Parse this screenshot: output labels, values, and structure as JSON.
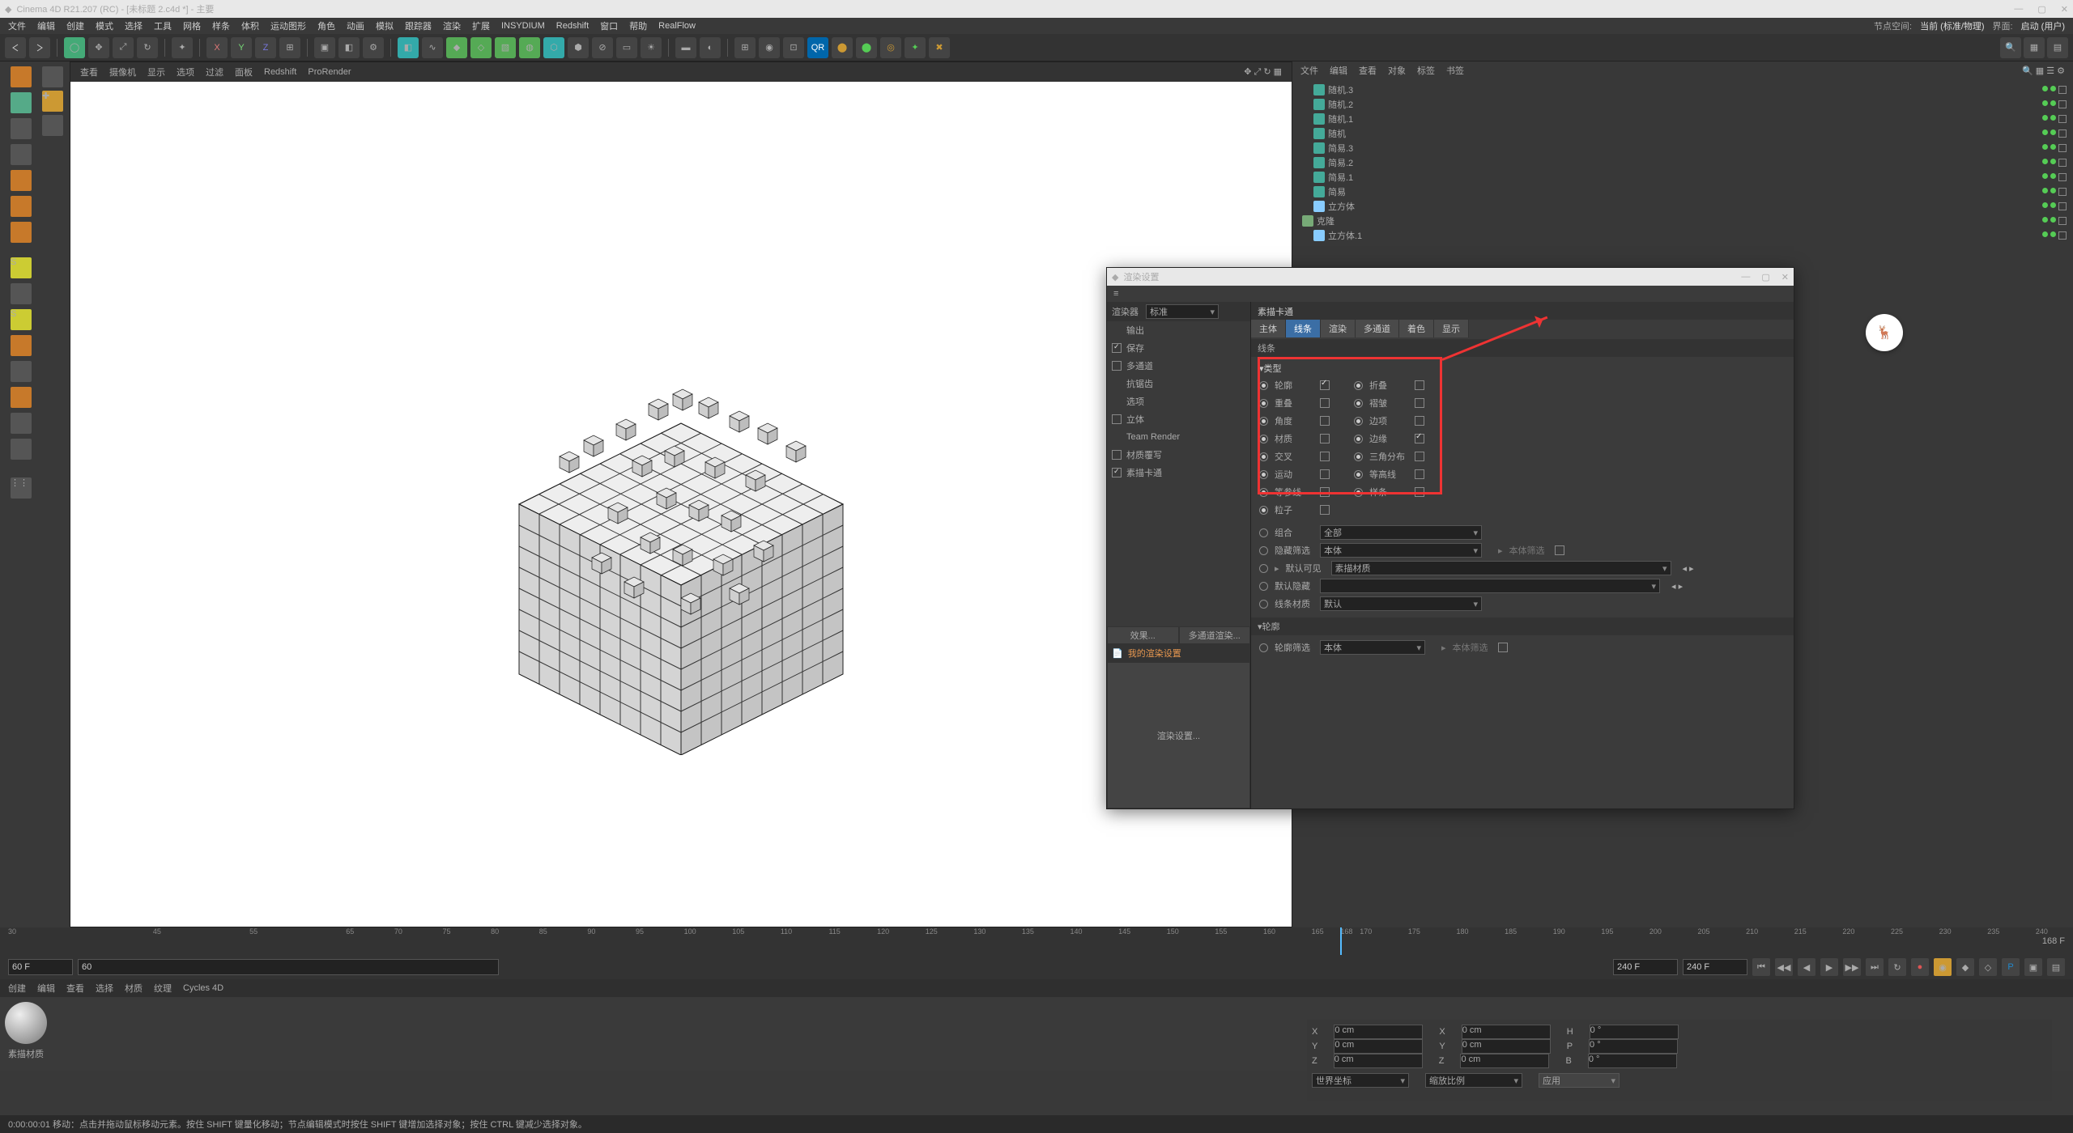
{
  "app": {
    "title": "Cinema 4D R21.207 (RC) - [未标题 2.c4d *] - 主要",
    "node_space_label": "节点空间:",
    "node_space_value": "当前 (标准/物理)",
    "layout_label": "界面:",
    "layout_value": "启动 (用户)"
  },
  "menus": [
    "文件",
    "编辑",
    "创建",
    "模式",
    "选择",
    "工具",
    "网格",
    "样条",
    "体积",
    "运动图形",
    "角色",
    "动画",
    "模拟",
    "跟踪器",
    "渲染",
    "扩展",
    "INSYDIUM",
    "Redshift",
    "窗口",
    "帮助",
    "RealFlow"
  ],
  "viewport_tabs": [
    "查看",
    "摄像机",
    "显示",
    "选项",
    "过滤",
    "面板",
    "Redshift",
    "ProRender"
  ],
  "objmgr_menu": [
    "文件",
    "编辑",
    "查看",
    "对象",
    "标签",
    "书签"
  ],
  "objects": [
    {
      "name": "随机.3",
      "icon": "oi-b",
      "indent": 1
    },
    {
      "name": "随机.2",
      "icon": "oi-b",
      "indent": 1
    },
    {
      "name": "随机.1",
      "icon": "oi-b",
      "indent": 1
    },
    {
      "name": "随机",
      "icon": "oi-b",
      "indent": 1
    },
    {
      "name": "简易.3",
      "icon": "oi-b",
      "indent": 1
    },
    {
      "name": "简易.2",
      "icon": "oi-b",
      "indent": 1
    },
    {
      "name": "简易.1",
      "icon": "oi-b",
      "indent": 1
    },
    {
      "name": "简易",
      "icon": "oi-b",
      "indent": 1
    },
    {
      "name": "立方体",
      "icon": "oi-c",
      "indent": 1
    },
    {
      "name": "克隆",
      "icon": "oi-g",
      "indent": 0
    },
    {
      "name": "立方体.1",
      "icon": "oi-c",
      "indent": 1
    }
  ],
  "timeline": {
    "start": 30,
    "end": 240,
    "current": 168,
    "ticks": [
      30,
      45,
      55,
      65,
      70,
      75,
      80,
      85,
      90,
      95,
      100,
      105,
      110,
      115,
      120,
      125,
      130,
      135,
      140,
      145,
      150,
      155,
      160,
      165,
      168,
      170,
      175,
      180,
      185,
      190,
      195,
      200,
      205,
      210,
      215,
      220,
      225,
      230,
      235,
      240
    ],
    "end_label": "168 F",
    "field_start": "60 F",
    "field_cur": "60",
    "field_end": "240 F",
    "field_total": "240 F"
  },
  "material_menu": [
    "创建",
    "编辑",
    "查看",
    "选择",
    "材质",
    "纹理",
    "Cycles 4D"
  ],
  "material_label": "素描材质",
  "coords": {
    "rows": [
      {
        "a": "X",
        "av": "0 cm",
        "b": "X",
        "bv": "0 cm",
        "c": "H",
        "cv": "0 °"
      },
      {
        "a": "Y",
        "av": "0 cm",
        "b": "Y",
        "bv": "0 cm",
        "c": "P",
        "cv": "0 °"
      },
      {
        "a": "Z",
        "av": "0 cm",
        "b": "Z",
        "bv": "0 cm",
        "c": "B",
        "cv": "0 °"
      }
    ],
    "mode1": "世界坐标",
    "mode2": "缩放比例",
    "apply": "应用"
  },
  "statusbar": "0:00:00:01   移动：点击并拖动鼠标移动元素。按住 SHIFT 键量化移动；节点编辑模式时按住 SHIFT 键增加选择对象；按住 CTRL 键减少选择对象。",
  "render_settings": {
    "title": "渲染设置",
    "renderer_label": "渲染器",
    "renderer_value": "标准",
    "left_items": [
      {
        "label": "输出",
        "cb": null
      },
      {
        "label": "保存",
        "cb": true
      },
      {
        "label": "多通道",
        "cb": false
      },
      {
        "label": "抗锯齿",
        "cb": null
      },
      {
        "label": "选项",
        "cb": null
      },
      {
        "label": "立体",
        "cb": false
      },
      {
        "label": "Team Render",
        "cb": null
      },
      {
        "label": "材质覆写",
        "cb": false
      },
      {
        "label": "素描卡通",
        "cb": true,
        "active": true
      }
    ],
    "left_buttons": [
      "效果...",
      "多通道渲染..."
    ],
    "my_settings": "我的渲染设置",
    "save_btn": "渲染设置...",
    "panel_title": "素描卡通",
    "tabs": [
      "主体",
      "线条",
      "渲染",
      "多通道",
      "着色",
      "显示"
    ],
    "active_tab": 1,
    "section_lines": "线条",
    "section_types": "▾类型",
    "checkrows": [
      {
        "l": "轮廓",
        "lc": true,
        "r": "折叠",
        "rc": false
      },
      {
        "l": "重叠",
        "lc": false,
        "r": "褶皱",
        "rc": false
      },
      {
        "l": "角度",
        "lc": false,
        "r": "边项",
        "rc": false
      },
      {
        "l": "材质",
        "lc": false,
        "r": "边缘",
        "rc": true
      },
      {
        "l": "交叉",
        "lc": false,
        "r": "三角分布",
        "rc": false
      },
      {
        "l": "运动",
        "lc": false,
        "r": "等高线",
        "rc": false
      },
      {
        "l": "等参线",
        "lc": false,
        "r": "样条",
        "rc": false
      }
    ],
    "extra_row": {
      "l": "粒子",
      "lc": false
    },
    "combine": {
      "label": "组合",
      "value": "全部"
    },
    "hidden": {
      "label": "隐藏筛选",
      "value": "本体",
      "extra": "本体筛选"
    },
    "visible": {
      "label": "默认可见",
      "value": "素描材质"
    },
    "hidden2": {
      "label": "默认隐藏"
    },
    "linemat": {
      "label": "线条材质",
      "value": "默认"
    },
    "section_outline": "▾轮廓",
    "outline_filter": {
      "label": "轮廓筛选",
      "value": "本体",
      "extra": "本体筛选"
    }
  }
}
